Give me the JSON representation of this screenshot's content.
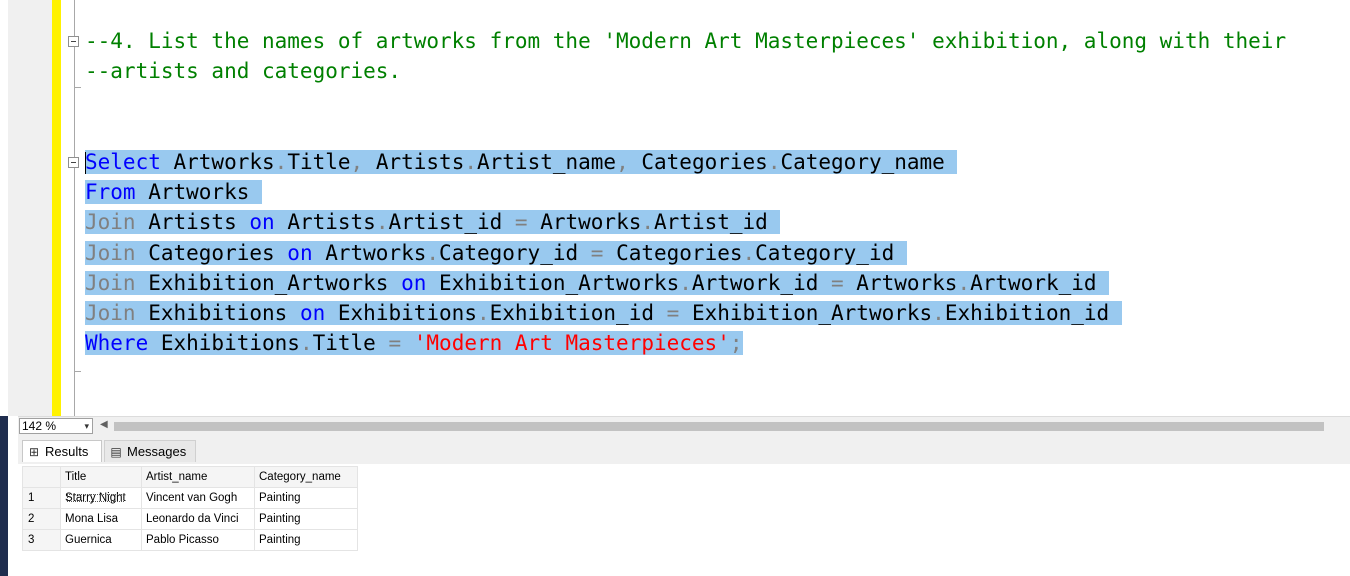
{
  "editor": {
    "comment_line1": "--4. List the names of artworks from the 'Modern Art Masterpieces' exhibition, along with their",
    "comment_line2": "--artists and categories.",
    "sql": {
      "l1_kw": "Select",
      "l1_rest_a": " Artworks",
      "l1_dot1": ".",
      "l1_rest_b": "Title",
      "l1_comma1": ",",
      "l1_rest_c": " Artists",
      "l1_dot2": ".",
      "l1_rest_d": "Artist_name",
      "l1_comma2": ",",
      "l1_rest_e": " Categories",
      "l1_dot3": ".",
      "l1_rest_f": "Category_name ",
      "l2_kw": "From",
      "l2_rest": " Artworks ",
      "l3_kw": "Join",
      "l3_a": " Artists ",
      "l3_on": "on",
      "l3_b": " Artists",
      "l3_c": "Artist_id ",
      "l3_eq": "=",
      "l3_d": " Artworks",
      "l3_e": "Artist_id ",
      "l4_kw": "Join",
      "l4_a": " Categories ",
      "l4_on": "on",
      "l4_b": " Artworks",
      "l4_c": "Category_id ",
      "l4_eq": "=",
      "l4_d": " Categories",
      "l4_e": "Category_id ",
      "l5_kw": "Join",
      "l5_a": " Exhibition_Artworks ",
      "l5_on": "on",
      "l5_b": " Exhibition_Artworks",
      "l5_c": "Artwork_id ",
      "l5_eq": "=",
      "l5_d": " Artworks",
      "l5_e": "Artwork_id ",
      "l6_kw": "Join",
      "l6_a": " Exhibitions ",
      "l6_on": "on",
      "l6_b": " Exhibitions",
      "l6_c": "Exhibition_id ",
      "l6_eq": "=",
      "l6_d": " Exhibition_Artworks",
      "l6_e": "Exhibition_id ",
      "l7_kw": "Where",
      "l7_a": " Exhibitions",
      "l7_b": "Title ",
      "l7_eq": "=",
      "l7_str": "'Modern Art Masterpieces'",
      "l7_semi": ";",
      "dot": "."
    }
  },
  "zoom": {
    "value": "142 %",
    "arrow": "▾"
  },
  "results": {
    "tabs": {
      "results_label": "Results",
      "messages_label": "Messages"
    },
    "columns": [
      "Title",
      "Artist_name",
      "Category_name"
    ],
    "rows": [
      {
        "num": "1",
        "title": "Starry Night",
        "artist": "Vincent van Gogh",
        "category": "Painting"
      },
      {
        "num": "2",
        "title": "Mona Lisa",
        "artist": "Leonardo da Vinci",
        "category": "Painting"
      },
      {
        "num": "3",
        "title": "Guernica",
        "artist": "Pablo Picasso",
        "category": "Painting"
      }
    ]
  }
}
